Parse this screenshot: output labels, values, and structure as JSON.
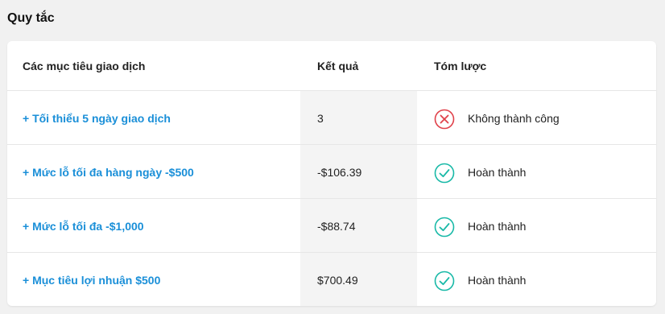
{
  "section_title": "Quy tắc",
  "table": {
    "headers": [
      "Các mục tiêu giao dịch",
      "Kết quả",
      "Tóm lược"
    ],
    "rows": [
      {
        "goal": "+ Tối thiểu 5 ngày giao dịch",
        "result": "3",
        "status": "Không thành công",
        "status_icon": "x-circle-icon",
        "status_color": "#e0414a"
      },
      {
        "goal": "+ Mức lỗ tối đa hàng ngày -$500",
        "result": "-$106.39",
        "status": "Hoàn thành",
        "status_icon": "check-circle-icon",
        "status_color": "#18b9a7"
      },
      {
        "goal": "+ Mức lỗ tối đa -$1,000",
        "result": "-$88.74",
        "status": "Hoàn thành",
        "status_icon": "check-circle-icon",
        "status_color": "#18b9a7"
      },
      {
        "goal": "+ Mục tiêu lợi nhuận $500",
        "result": "$700.49",
        "status": "Hoàn thành",
        "status_icon": "check-circle-icon",
        "status_color": "#18b9a7"
      }
    ]
  },
  "colors": {
    "link": "#1a8fd8",
    "fail": "#e0414a",
    "success": "#18b9a7"
  }
}
